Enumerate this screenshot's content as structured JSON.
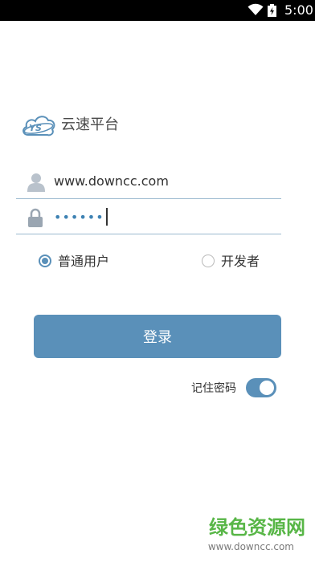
{
  "status_bar": {
    "time": "5:00",
    "icons": [
      "wifi-icon",
      "battery-icon"
    ]
  },
  "brand": {
    "logo_text": "YS",
    "title": "云速平台"
  },
  "login_form": {
    "username": {
      "value": "www.downcc.com",
      "icon": "user-icon"
    },
    "password": {
      "value": "••••••",
      "icon": "lock-icon"
    },
    "user_type": {
      "options": [
        "普通用户",
        "开发者"
      ],
      "selected": "普通用户"
    },
    "login_button": "登录",
    "remember": {
      "label": "记住密码",
      "enabled": true
    }
  },
  "colors": {
    "accent": "#5a90b9",
    "underline": "#9bb9cf",
    "watermark": "#58b647"
  },
  "watermark": {
    "title": "绿色资源网",
    "url": "www.downcc.com"
  }
}
